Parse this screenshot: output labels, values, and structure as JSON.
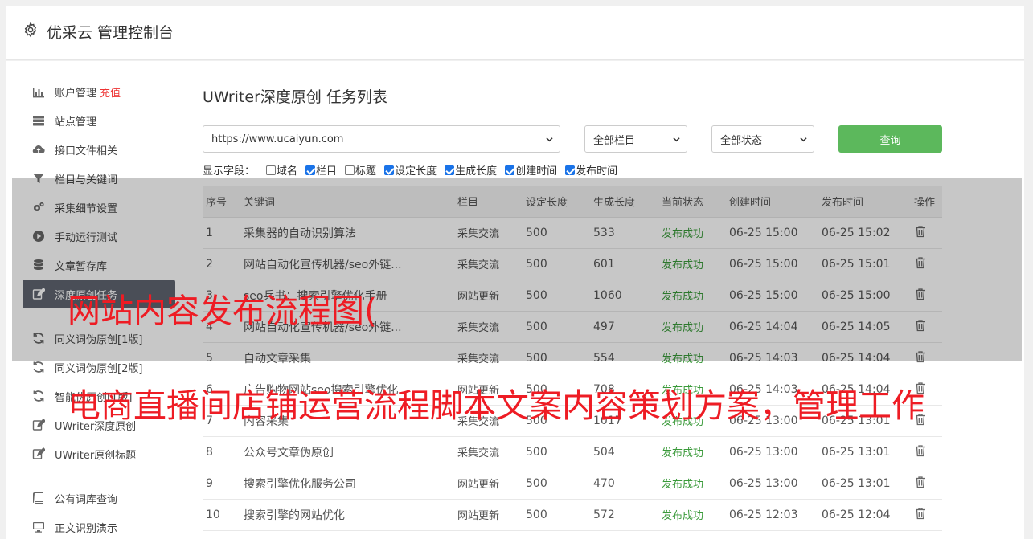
{
  "header": {
    "title": "优采云 管理控制台",
    "icon": "gear-icon"
  },
  "sidebar": {
    "items": [
      {
        "label": "账户管理",
        "extra": "充值",
        "icon": "bar-chart-icon"
      },
      {
        "label": "站点管理",
        "icon": "server-icon"
      },
      {
        "label": "接口文件相关",
        "icon": "cloud-upload-icon"
      },
      {
        "label": "栏目与关键词",
        "icon": "filter-icon"
      },
      {
        "label": "采集细节设置",
        "icon": "gears-icon"
      },
      {
        "label": "手动运行测试",
        "icon": "play-circle-icon"
      },
      {
        "label": "文章暂存库",
        "icon": "database-icon"
      },
      {
        "label": "深度原创任务",
        "icon": "edit-icon",
        "active": true
      }
    ],
    "items2": [
      {
        "label": "同义词伪原创[1版]",
        "icon": "refresh-icon"
      },
      {
        "label": "同义词伪原创[2版]",
        "icon": "refresh-icon"
      },
      {
        "label": "智能伪原创[1版]",
        "icon": "refresh-icon"
      },
      {
        "label": "UWriter深度原创",
        "icon": "edit-icon"
      },
      {
        "label": "UWriter原创标题",
        "icon": "edit-icon"
      }
    ],
    "items3": [
      {
        "label": "公有词库查询",
        "icon": "book-icon"
      },
      {
        "label": "正文识别演示",
        "icon": "monitor-icon"
      }
    ]
  },
  "main": {
    "title": "UWriter深度原创 任务列表",
    "site_select": "https://www.ucaiyun.com",
    "category_select": "全部栏目",
    "status_select": "全部状态",
    "query_button": "查询",
    "fields_label": "显示字段：",
    "fields": [
      {
        "label": "域名",
        "checked": false
      },
      {
        "label": "栏目",
        "checked": true
      },
      {
        "label": "标题",
        "checked": false
      },
      {
        "label": "设定长度",
        "checked": true
      },
      {
        "label": "生成长度",
        "checked": true
      },
      {
        "label": "创建时间",
        "checked": true
      },
      {
        "label": "发布时间",
        "checked": true
      }
    ],
    "columns": [
      "序号",
      "关键词",
      "栏目",
      "设定长度",
      "生成长度",
      "当前状态",
      "创建时间",
      "发布时间",
      "操作"
    ],
    "rows": [
      [
        "1",
        "采集器的自动识别算法",
        "采集交流",
        "500",
        "533",
        "发布成功",
        "06-25 15:00",
        "06-25 15:02"
      ],
      [
        "2",
        "网站自动化宣传机器/seo外链...",
        "采集交流",
        "500",
        "601",
        "发布成功",
        "06-25 15:00",
        "06-25 15:01"
      ],
      [
        "3",
        "seo兵书：搜索引擎优化手册",
        "网站更新",
        "500",
        "1060",
        "发布成功",
        "06-25 15:00",
        "06-25 15:00"
      ],
      [
        "4",
        "网站自动化宣传机器/seo外链...",
        "采集交流",
        "500",
        "497",
        "发布成功",
        "06-25 14:04",
        "06-25 14:05"
      ],
      [
        "5",
        "自动文章采集",
        "采集交流",
        "500",
        "554",
        "发布成功",
        "06-25 14:03",
        "06-25 14:04"
      ],
      [
        "6",
        "广告购物网站seo搜索引擎优化",
        "网站更新",
        "500",
        "708",
        "发布成功",
        "06-25 14:03",
        "06-25 14:04"
      ],
      [
        "7",
        "内容采集",
        "采集交流",
        "500",
        "1017",
        "发布成功",
        "06-25 13:00",
        "06-25 13:01"
      ],
      [
        "8",
        "公众号文章伪原创",
        "采集交流",
        "500",
        "504",
        "发布成功",
        "06-25 13:00",
        "06-25 13:01"
      ],
      [
        "9",
        "搜索引擎优化服务公司",
        "网站更新",
        "500",
        "470",
        "发布成功",
        "06-25 13:00",
        "06-25 13:01"
      ],
      [
        "10",
        "搜索引擎的网站优化",
        "网站更新",
        "500",
        "572",
        "发布成功",
        "06-25 12:03",
        "06-25 12:04"
      ]
    ]
  },
  "banners": {
    "line1": "网站内容发布流程图(",
    "line2": "电商直播间店铺运营流程脚本文案内容策划方案，管理工作"
  }
}
